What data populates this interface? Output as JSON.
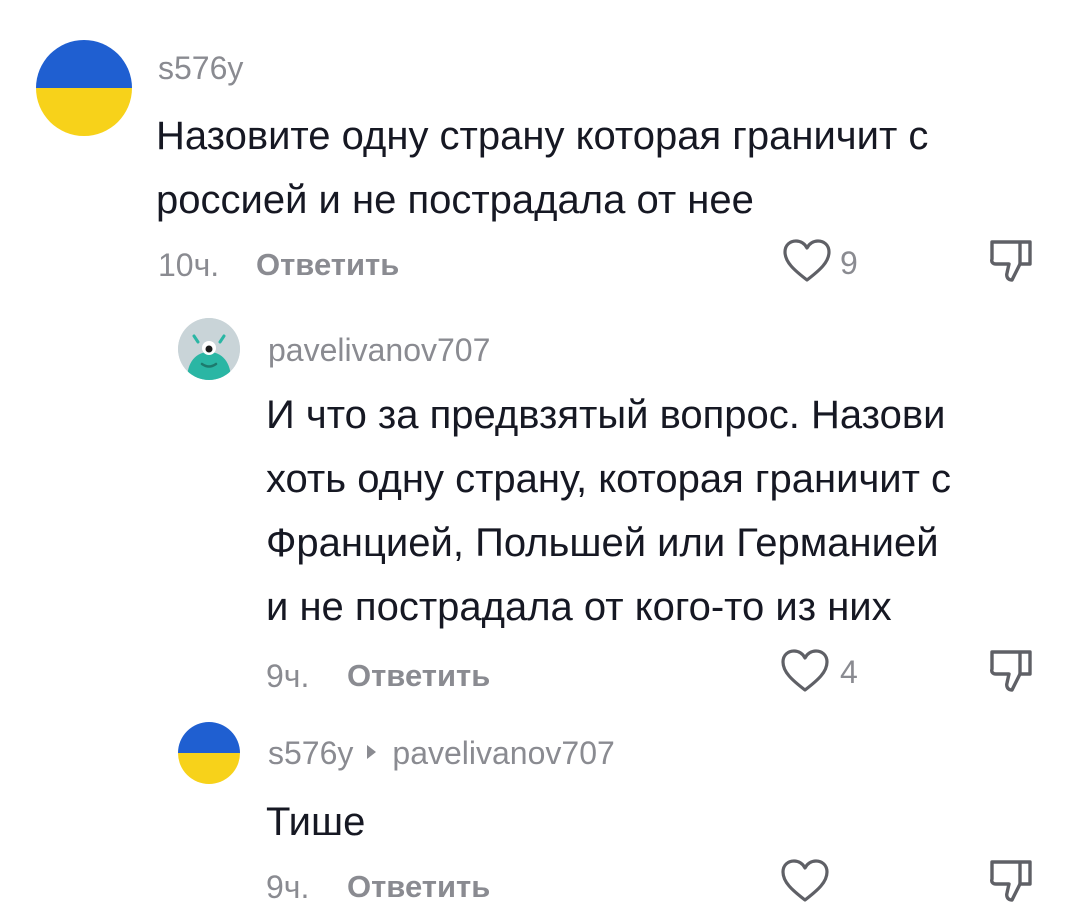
{
  "comments": [
    {
      "username": "s576y",
      "text_lines": [
        "Назовите одну страну которая граничит с",
        "россией и не пострадала от нее"
      ],
      "time": "10ч.",
      "reply_label": "Ответить",
      "likes": "9"
    },
    {
      "username": "pavelivanov707",
      "text_lines": [
        "И что за предвзятый вопрос. Назови",
        "хоть одну страну, которая граничит с",
        "Францией, Польшей или Германией",
        "и не пострадала от кого-то из них"
      ],
      "time": "9ч.",
      "reply_label": "Ответить",
      "likes": "4"
    },
    {
      "username": "s576y",
      "reply_to": "pavelivanov707",
      "text_lines": [
        "Тише"
      ],
      "time": "9ч.",
      "reply_label": "Ответить",
      "likes": ""
    }
  ],
  "icons": {
    "like": "heart-outline-icon",
    "dislike": "thumbs-down-icon"
  },
  "colors": {
    "flag_blue": "#1f5fd1",
    "flag_yellow": "#f7d21a",
    "avatar_teal": "#2ab6a4",
    "meta_gray": "#8a8b91",
    "text": "#161823"
  }
}
